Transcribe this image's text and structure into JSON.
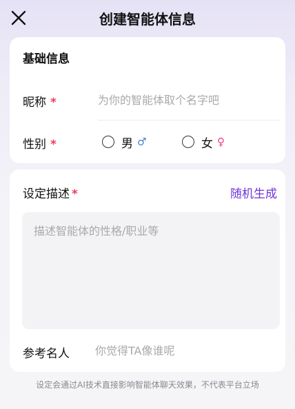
{
  "header": {
    "title": "创建智能体信息",
    "close_icon": "close-icon"
  },
  "basic": {
    "section_title": "基础信息",
    "nickname_label": "昵称",
    "required_mark": "*",
    "nickname_placeholder": "为你的智能体取个名字吧",
    "gender_label": "性别",
    "gender_options": [
      {
        "label": "男",
        "symbol": "♂",
        "icon": "male-icon",
        "selected": false
      },
      {
        "label": "女",
        "symbol": "♀",
        "icon": "female-icon",
        "selected": false
      }
    ]
  },
  "description": {
    "label": "设定描述",
    "required_mark": "*",
    "random_label": "随机生成",
    "placeholder": "描述智能体的性格/职业等",
    "reference_label": "参考名人",
    "reference_placeholder": "你觉得TA像谁呢"
  },
  "footer": {
    "note": "设定会通过AI技术直接影响智能体聊天效果，不代表平台立场"
  },
  "colors": {
    "accent": "#6f35d8",
    "required": "#ef3b5a",
    "male": "#4b7dd8",
    "female": "#ef3b86"
  }
}
